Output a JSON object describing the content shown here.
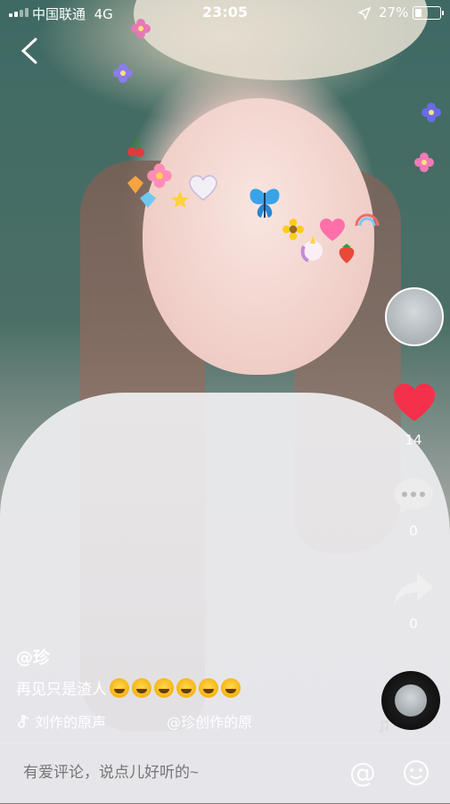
{
  "status_bar": {
    "carrier": "中国联通",
    "network": "4G",
    "time": "23:05",
    "battery_percent": "27%",
    "battery_level": 0.27,
    "icons": [
      "signal-icon",
      "location-arrow-icon",
      "battery-icon"
    ]
  },
  "nav": {
    "back_icon": "chevron-left-icon"
  },
  "sidebar": {
    "like_count": "14",
    "comment_count": "0",
    "share_count": "0",
    "like_color": "#f5304a"
  },
  "post": {
    "author": "@珍",
    "caption": "再见只是渣人",
    "caption_emoji_count": 6,
    "music_title_visible": "刘作的原声",
    "music_title_next": "@珍创作的原"
  },
  "comment_bar": {
    "placeholder": "有爱评论，说点儿好听的~",
    "at_symbol": "@"
  }
}
